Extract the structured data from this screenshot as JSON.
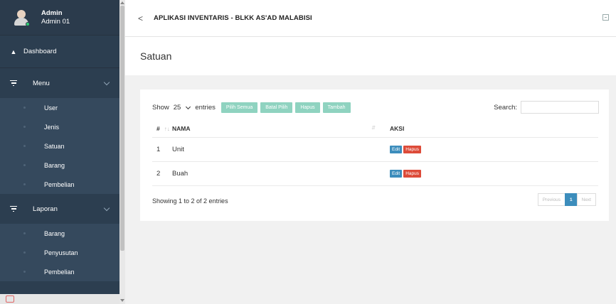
{
  "sidebar": {
    "profile": {
      "role": "Admin",
      "name": "Admin 01"
    },
    "dashboard": {
      "label": "Dashboard",
      "icon": "dashboard-icon"
    },
    "groups": [
      {
        "label": "Menu",
        "icon": "filter-icon",
        "items": [
          {
            "label": "User"
          },
          {
            "label": "Jenis"
          },
          {
            "label": "Satuan"
          },
          {
            "label": "Barang"
          },
          {
            "label": "Pembelian"
          }
        ]
      },
      {
        "label": "Laporan",
        "icon": "filter-icon",
        "items": [
          {
            "label": "Barang"
          },
          {
            "label": "Penyusutan"
          },
          {
            "label": "Pembelian"
          }
        ]
      }
    ]
  },
  "header": {
    "back": "<",
    "title": "APLIKASI INVENTARIS - BLKK AS'AD MALABISI"
  },
  "page": {
    "title": "Satuan"
  },
  "toolbar": {
    "show_label": "Show",
    "entries_value": "25",
    "entries_label": "entries",
    "buttons": [
      "Pilih Semua",
      "Batal Pilih",
      "Hapus",
      "Tambah"
    ],
    "search_label": "Search:"
  },
  "table": {
    "headers": {
      "no": "#",
      "nama": "NAMA",
      "aksi": "AKSI"
    },
    "rows": [
      {
        "no": "1",
        "nama": "Unit",
        "edit": "Edit",
        "hapus": "Hapus"
      },
      {
        "no": "2",
        "nama": "Buah",
        "edit": "Edit",
        "hapus": "Hapus"
      }
    ]
  },
  "footer": {
    "info": "Showing 1 to 2 of 2 entries"
  },
  "pagination": {
    "previous": "Previous",
    "current": "1",
    "next": "Next"
  },
  "colors": {
    "sidebar": "#2c3e50",
    "submenu": "#35495d",
    "button": "#8fd3c0",
    "edit": "#3c8dbc",
    "hapus": "#dd4b39"
  }
}
